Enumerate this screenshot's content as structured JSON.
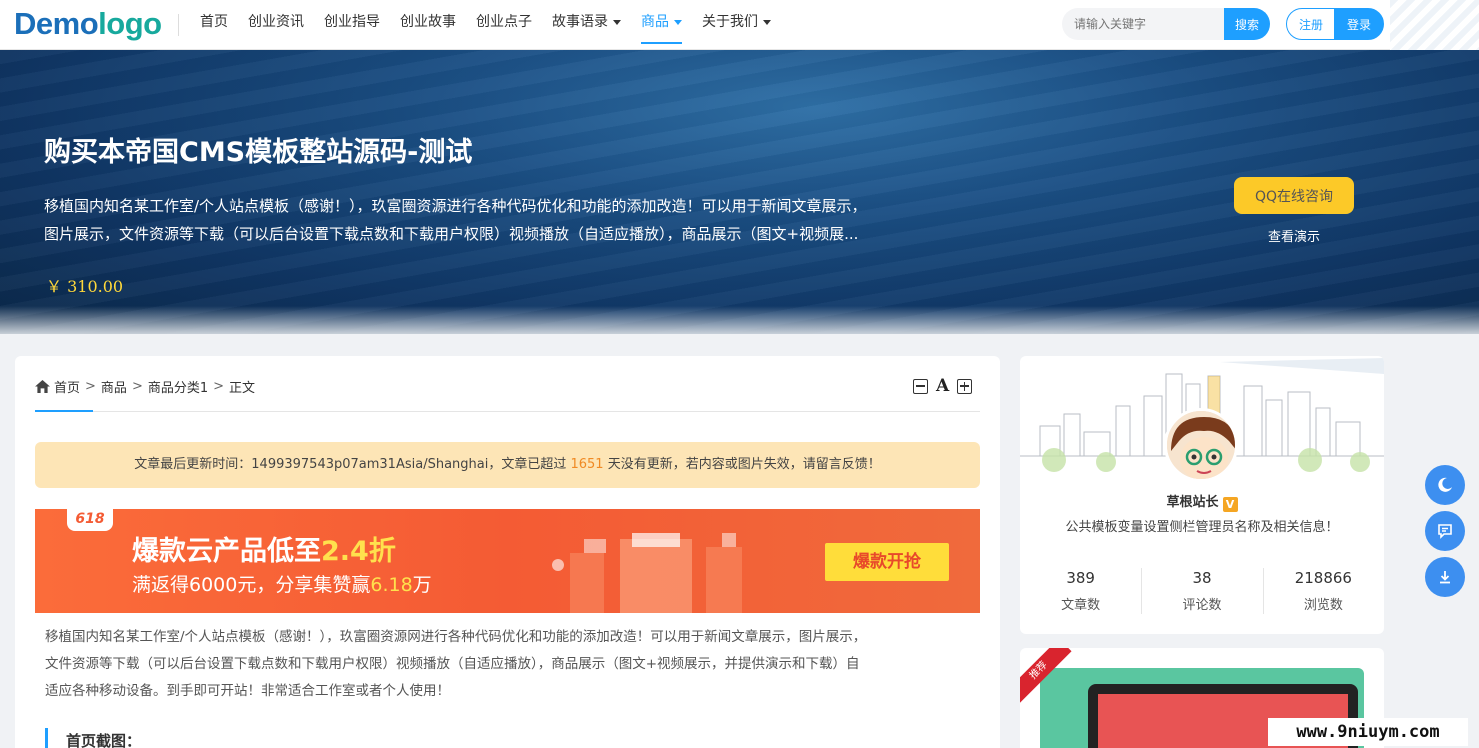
{
  "header": {
    "logo_part1": "Demo",
    "logo_part2": "logo",
    "nav": [
      {
        "label": "首页"
      },
      {
        "label": "创业资讯"
      },
      {
        "label": "创业指导"
      },
      {
        "label": "创业故事"
      },
      {
        "label": "创业点子"
      },
      {
        "label": "故事语录"
      },
      {
        "label": "商品"
      },
      {
        "label": "关于我们"
      }
    ],
    "active_nav": "商品",
    "search_placeholder": "请输入关键字",
    "search_label": "搜索",
    "register_label": "注册",
    "login_label": "登录"
  },
  "banner": {
    "title": "购买本帝国CMS模板整站源码-测试",
    "desc_line1": "移植国内知名某工作室/个人站点模板（感谢！），玖富圈资源进行各种代码优化和功能的添加改造！可以用于新闻文章展示，",
    "desc_line2": "图片展示，文件资源等下载（可以后台设置下载点数和下载用户权限）视频播放（自适应播放），商品展示（图文+视频展...",
    "price": "￥ 310.00",
    "qq_label": "QQ在线咨询",
    "demo_label": "查看演示"
  },
  "breadcrumb": {
    "items": [
      "首页",
      "商品",
      "商品分类1",
      "正文"
    ],
    "sep": ">"
  },
  "font_tools": {
    "a_label": "A"
  },
  "notice": {
    "before": "文章最后更新时间：1499397543p07am31Asia/Shanghai，文章已超过 ",
    "days": "1651",
    "after": " 天没有更新，若内容或图片失效，请留言反馈！"
  },
  "ad": {
    "tag": "618",
    "h1_before": "爆款云产品低至",
    "h1_hl": "2.4折",
    "h2_before": "满返得6000元，分享集赞赢",
    "h2_hl": "6.18",
    "h2_after": "万",
    "button": "爆款开抢"
  },
  "article": {
    "line1": "移植国内知名某工作室/个人站点模板（感谢！），玖富圈资源网进行各种代码优化和功能的添加改造！可以用于新闻文章展示，图片展示，",
    "line2": "文件资源等下载（可以后台设置下载点数和下载用户权限）视频播放（自适应播放），商品展示（图文+视频展示，并提供演示和下载）自",
    "line3": "适应各种移动设备。到手即可开站！非常适合工作室或者个人使用！",
    "subheading": "首页截图："
  },
  "profile": {
    "name": "草根站长",
    "badge": "V",
    "desc": "公共模板变量设置侧栏管理员名称及相关信息！",
    "stats": [
      {
        "value": "389",
        "label": "文章数"
      },
      {
        "value": "38",
        "label": "评论数"
      },
      {
        "value": "218866",
        "label": "浏览数"
      }
    ]
  },
  "promo": {
    "ribbon": "推荐"
  },
  "watermark": "www.9niuym.com",
  "colors": {
    "accent": "#1e9fff",
    "price": "#ffd83a",
    "qq_button": "#fcc928",
    "notice_bg": "#fde5b6",
    "notice_days": "#f08a24",
    "ad_bg": "#f45b34",
    "float_button": "#3d8ff0"
  },
  "icons": [
    "home-icon",
    "font-decrease-icon",
    "font-increase-icon",
    "moon-icon",
    "comment-icon",
    "download-icon"
  ]
}
